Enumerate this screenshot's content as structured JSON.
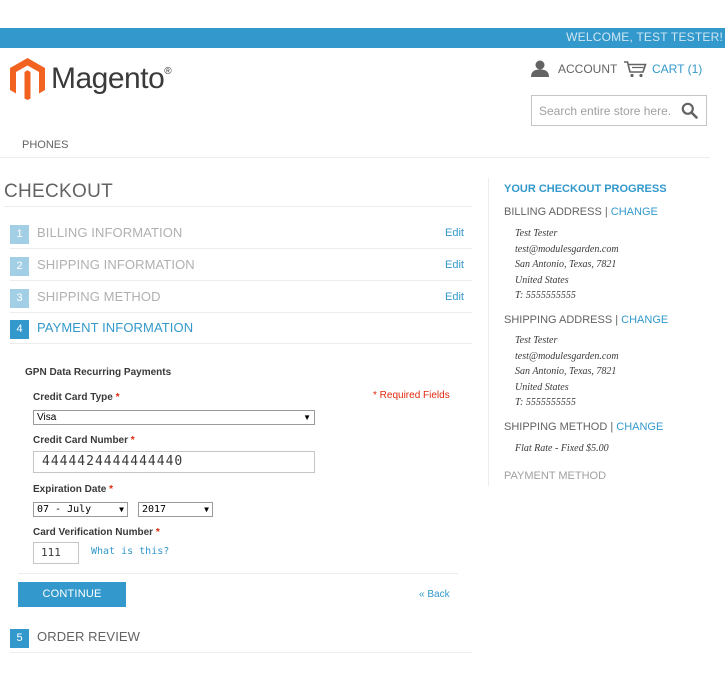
{
  "header": {
    "welcome": "WELCOME, TEST TESTER!",
    "logo_text": "Magento",
    "logo_mark": "®",
    "account_label": "ACCOUNT",
    "cart_label": "CART (1)",
    "search_placeholder": "Search entire store here..."
  },
  "nav": {
    "items": [
      "PHONES"
    ]
  },
  "checkout": {
    "title": "CHECKOUT",
    "edit_label": "Edit",
    "steps": [
      {
        "num": "1",
        "title": "BILLING INFORMATION"
      },
      {
        "num": "2",
        "title": "SHIPPING INFORMATION"
      },
      {
        "num": "3",
        "title": "SHIPPING METHOD"
      },
      {
        "num": "4",
        "title": "PAYMENT INFORMATION"
      },
      {
        "num": "5",
        "title": "ORDER REVIEW"
      }
    ]
  },
  "payment": {
    "method_name": "GPN Data Recurring Payments",
    "required_fields": "* Required Fields",
    "cc_type_label": "Credit Card Type",
    "cc_type_value": "Visa",
    "cc_number_label": "Credit Card Number",
    "cc_number_value": "4444424444444440",
    "exp_label": "Expiration Date",
    "exp_month": "07 - July",
    "exp_year": "2017",
    "cvv_label": "Card Verification Number",
    "cvv_value": "111",
    "what_is_this": "What is this?",
    "required_mark": "*",
    "continue_label": "CONTINUE",
    "back_label": "« Back"
  },
  "progress": {
    "title": "YOUR CHECKOUT PROGRESS",
    "change_label": "CHANGE",
    "billing_label": "BILLING ADDRESS |",
    "billing_lines": [
      "Test Tester",
      "test@modulesgarden.com",
      "San Antonio, Texas, 7821",
      "United States",
      "T: 5555555555"
    ],
    "shipping_label": "SHIPPING ADDRESS |",
    "shipping_lines": [
      "Test Tester",
      "test@modulesgarden.com",
      "San Antonio, Texas, 7821",
      "United States",
      "T: 5555555555"
    ],
    "method_label": "SHIPPING METHOD |",
    "method_value": "Flat Rate - Fixed $5.00",
    "payment_label": "PAYMENT METHOD"
  },
  "colors": {
    "accent": "#3399cc",
    "logo_orange": "#f26322",
    "required": "#df280a"
  }
}
